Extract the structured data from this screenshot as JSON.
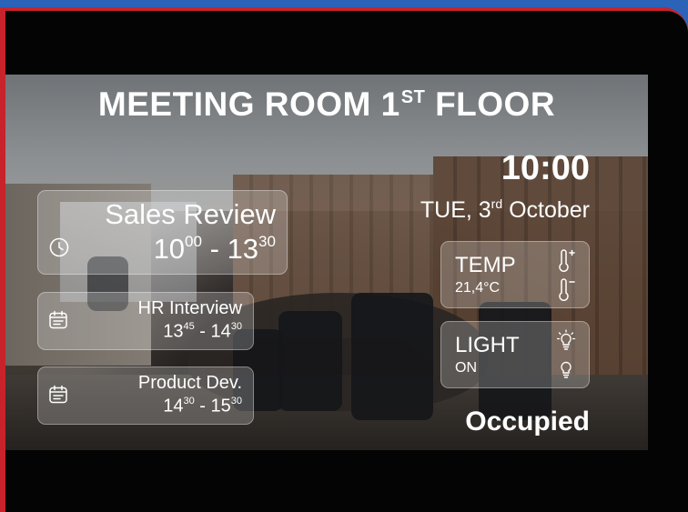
{
  "room": {
    "title_main": "MEETING ROOM 1",
    "title_sup": "ST",
    "title_end": " FLOOR"
  },
  "clock": {
    "time": "10:00",
    "date_prefix": "TUE, 3",
    "date_sup": "rd",
    "date_suffix": " October"
  },
  "events": [
    {
      "name": "Sales Review",
      "start_h": "10",
      "start_m": "00",
      "end_h": "13",
      "end_m": "30",
      "icon": "clock-icon"
    },
    {
      "name": "HR Interview",
      "start_h": "13",
      "start_m": "45",
      "end_h": "14",
      "end_m": "30",
      "icon": "calendar-icon"
    },
    {
      "name": "Product Dev.",
      "start_h": "14",
      "start_m": "30",
      "end_h": "15",
      "end_m": "30",
      "icon": "calendar-icon"
    }
  ],
  "time_separator": " - ",
  "temperature": {
    "label": "TEMP",
    "value": "21,4°C",
    "icons": [
      "thermometer-plus-icon",
      "thermometer-minus-icon"
    ]
  },
  "light": {
    "label": "LIGHT",
    "value": "ON",
    "icons": [
      "bulb-on-icon",
      "bulb-off-icon"
    ]
  },
  "status": "Occupied",
  "colors": {
    "bezel_red": "#c8222b",
    "frame_blue": "#2b63b8",
    "text": "#ffffff"
  }
}
